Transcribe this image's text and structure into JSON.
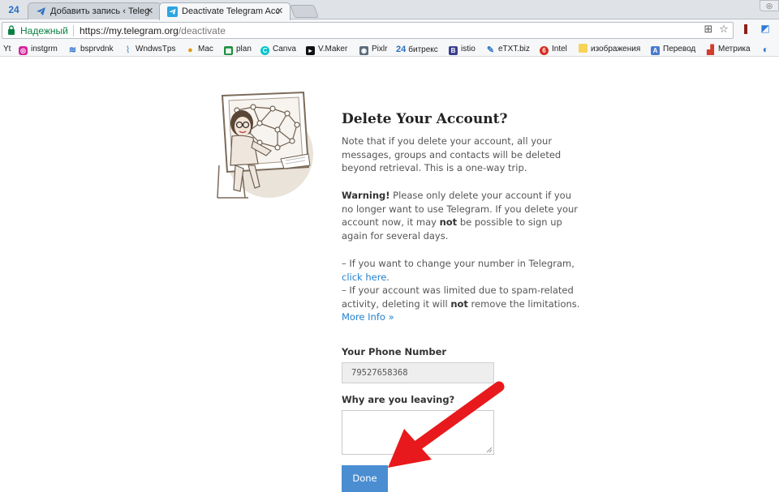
{
  "browser": {
    "tabs": [
      {
        "label": "24"
      },
      {
        "label": "Добавить запись ‹ Teleg",
        "close": "✕"
      },
      {
        "label": "Deactivate Telegram Acc",
        "close": "✕"
      }
    ],
    "secure_label": "Надежный",
    "url_host": "https://my.telegram.org",
    "url_path": "/deactivate"
  },
  "bookmarks": [
    {
      "label": "Yt"
    },
    {
      "label": "instgrm"
    },
    {
      "label": "bsprvdnk"
    },
    {
      "label": "WndwsTps"
    },
    {
      "label": "Mac"
    },
    {
      "label": "plan"
    },
    {
      "label": "Canva"
    },
    {
      "label": "V.Maker"
    },
    {
      "label": "Pixlr"
    },
    {
      "label": "битрекс",
      "prefix": "24"
    },
    {
      "label": "istio"
    },
    {
      "label": "eTXT.biz"
    },
    {
      "label": "Intel"
    },
    {
      "label": "изображения"
    },
    {
      "label": "Перевод"
    },
    {
      "label": "Метрика"
    }
  ],
  "page": {
    "title": "Delete Your Account?",
    "intro": "Note that if you delete your account, all your messages, groups and contacts will be deleted beyond retrieval. This is a one-way trip.",
    "warning_strong": "Warning!",
    "warning_part1": " Please only delete your account if you no longer want to use Telegram. If you delete your account now, it may ",
    "warning_not": "not",
    "warning_part2": " be possible to sign up again for several days.",
    "change_number_text": "– If you want to change your number in Telegram,",
    "click_here": "click here",
    "period": ".",
    "spam_part1": "– If your account was limited due to spam-related activity, deleting it will ",
    "spam_not": "not",
    "spam_part2": " remove the limitations.",
    "more_info": "More Info »",
    "phone_label": "Your Phone Number",
    "phone_value": "79527658368",
    "reason_label": "Why are you leaving?",
    "done_label": "Done"
  },
  "colors": {
    "link": "#2481cc",
    "button": "#4a8ed1",
    "arrow": "#e8191c",
    "secure": "#0b8043"
  }
}
